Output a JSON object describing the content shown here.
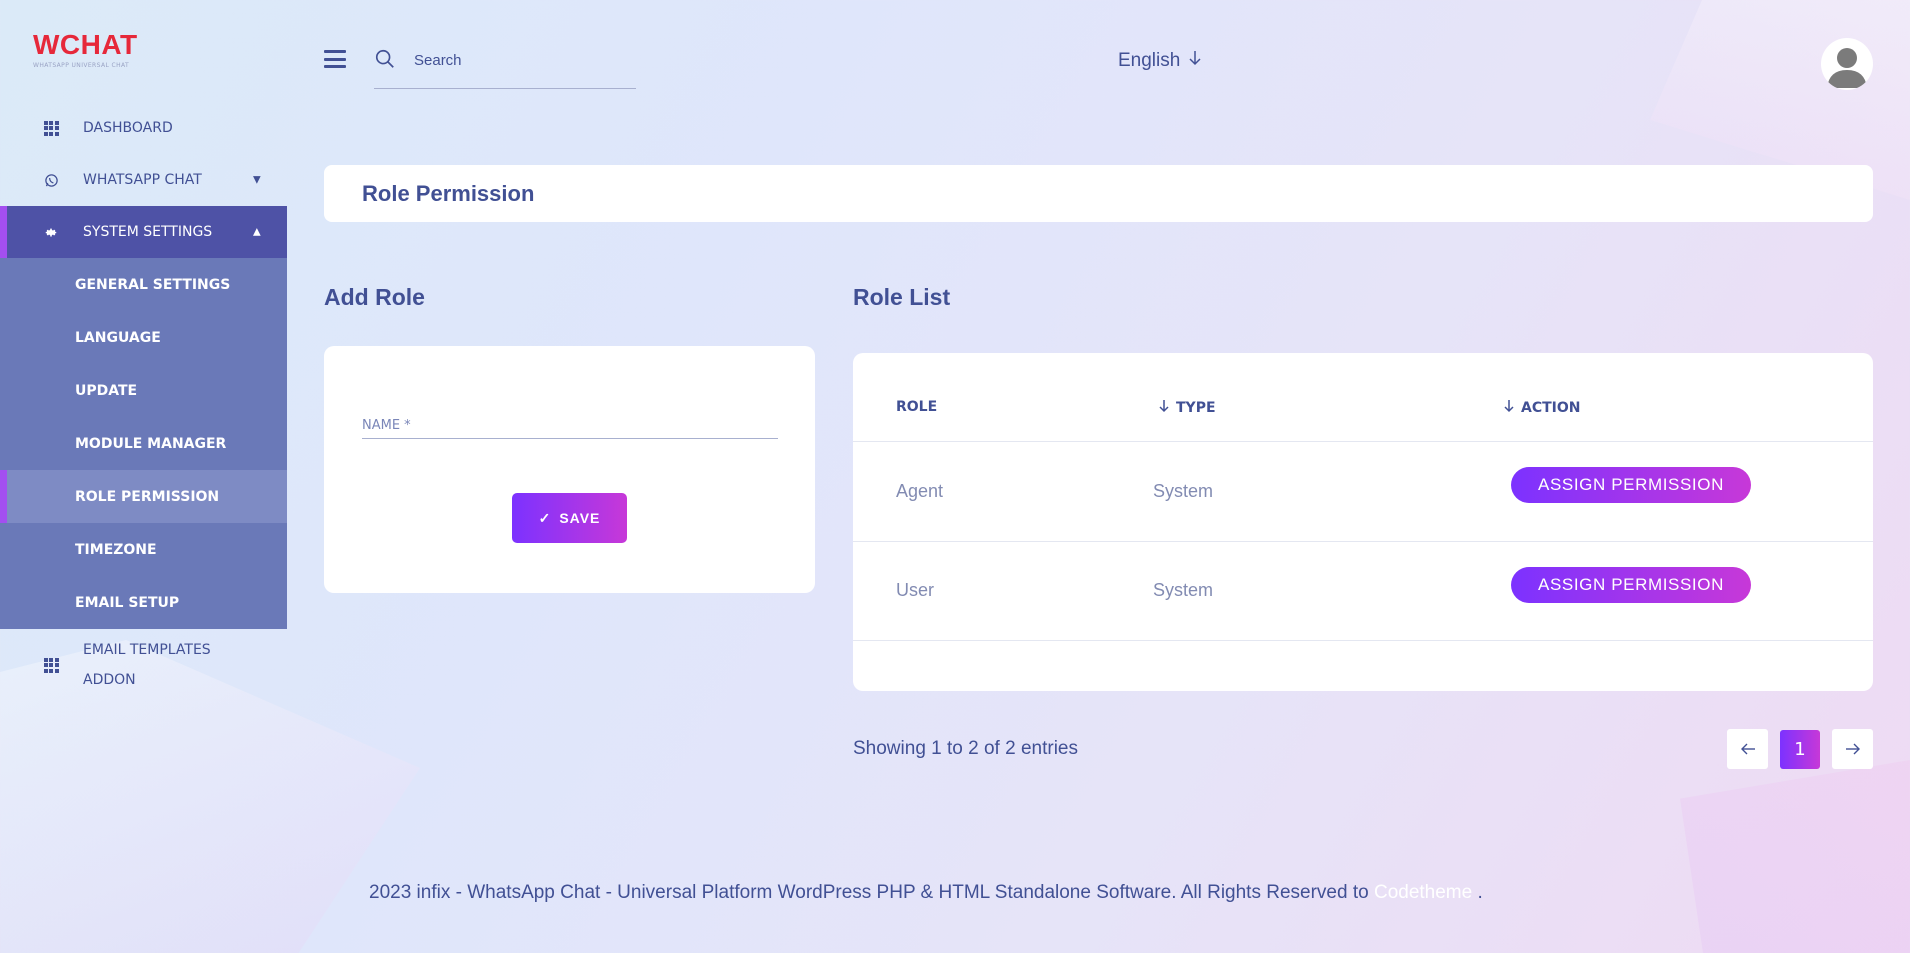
{
  "brand": {
    "title": "WCHAT",
    "subtitle": "WHATSAPP UNIVERSAL CHAT",
    "color": "#e6283a"
  },
  "header": {
    "search_placeholder": "Search",
    "language": "English"
  },
  "sidebar": {
    "items": [
      {
        "label": "DASHBOARD",
        "icon": "grid-icon"
      },
      {
        "label": "WHATSAPP CHAT",
        "icon": "whatsapp-icon"
      },
      {
        "label": "SYSTEM SETTINGS",
        "icon": "gear-icon"
      }
    ],
    "submenu": [
      {
        "label": "GENERAL SETTINGS"
      },
      {
        "label": "LANGUAGE"
      },
      {
        "label": "UPDATE"
      },
      {
        "label": "MODULE MANAGER"
      },
      {
        "label": "ROLE PERMISSION"
      },
      {
        "label": "TIMEZONE"
      },
      {
        "label": "EMAIL SETUP"
      }
    ],
    "last_item": {
      "label_line1": "EMAIL TEMPLATES",
      "label_line2": "ADDON",
      "icon": "grid-icon"
    }
  },
  "page": {
    "title": "Role Permission"
  },
  "add_role": {
    "title": "Add Role",
    "name_label": "NAME *",
    "save_label": "SAVE"
  },
  "role_list": {
    "title": "Role List",
    "columns": [
      "ROLE",
      "TYPE",
      "ACTION"
    ],
    "rows": [
      {
        "role": "Agent",
        "type": "System",
        "action": "ASSIGN PERMISSION"
      },
      {
        "role": "User",
        "type": "System",
        "action": "ASSIGN PERMISSION"
      }
    ],
    "showing": "Showing 1 to 2 of 2 entries",
    "current_page": "1"
  },
  "footer": {
    "text": "2023 infix - WhatsApp Chat - Universal Platform WordPress PHP & HTML Standalone Software. All Rights Reserved to",
    "link": "Codetheme",
    "end": "."
  },
  "colors": {
    "accent_start": "#7c32ff",
    "accent_end": "#c738d8",
    "primary_text": "#415094",
    "sidebar_active": "#4e52a6"
  }
}
